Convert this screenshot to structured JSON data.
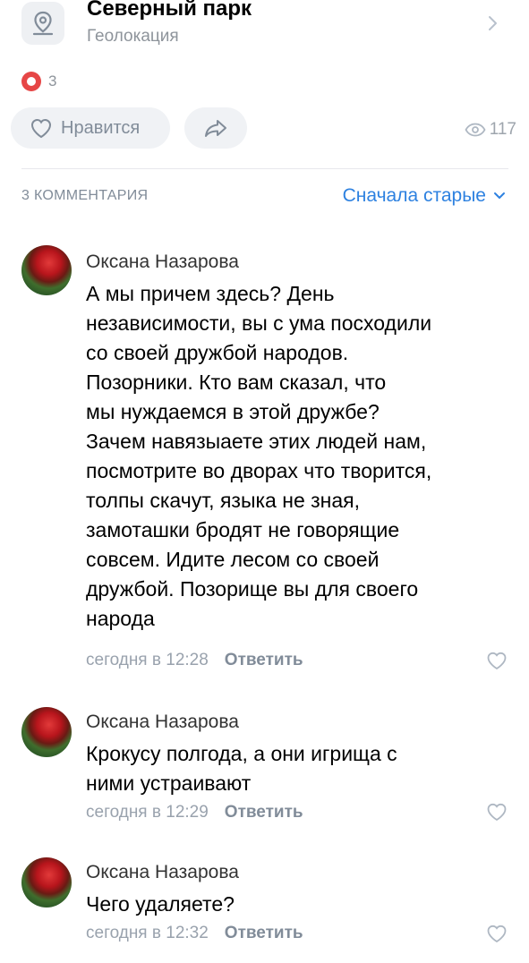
{
  "geo": {
    "title": "Северный парк",
    "subtitle": "Геолокация",
    "icon": "map-pin-icon"
  },
  "reactions": {
    "count": "3",
    "icon": "heart-reaction-icon",
    "color": "#e64646"
  },
  "actions": {
    "like_label": "Нравится",
    "share_icon": "share-arrow-icon"
  },
  "views": {
    "count": "117",
    "icon": "eye-icon"
  },
  "comments_header": {
    "count_label": "3 КОММЕНТАРИЯ",
    "sort_label": "Сначала старые",
    "accent": "#2d81e0"
  },
  "comments": [
    {
      "author": "Оксана Назарова",
      "text": "А мы причем здесь? День\nнезависимости, вы с ума посходили\nсо своей дружбой народов.\nПозорники. Кто вам сказал, что\nмы нуждаемся в этой дружбе?\nЗачем навязыаете этих людей нам,\nпосмотрите во дворах что творится,\nтолпы скачут, языка не зная,\nзамоташки бродят не говорящие\nсовсем. Идите лесом со своей\nдружбой. Позорище вы для своего\nнарода",
      "time": "сегодня в 12:28",
      "reply_label": "Ответить"
    },
    {
      "author": "Оксана Назарова",
      "text": "Крокусу полгода, а они игрища с\nними устраивают",
      "time": "сегодня в 12:29",
      "reply_label": "Ответить"
    },
    {
      "author": "Оксана Назарова",
      "text": "Чего удаляете?",
      "time": "сегодня в 12:32",
      "reply_label": "Ответить"
    }
  ]
}
